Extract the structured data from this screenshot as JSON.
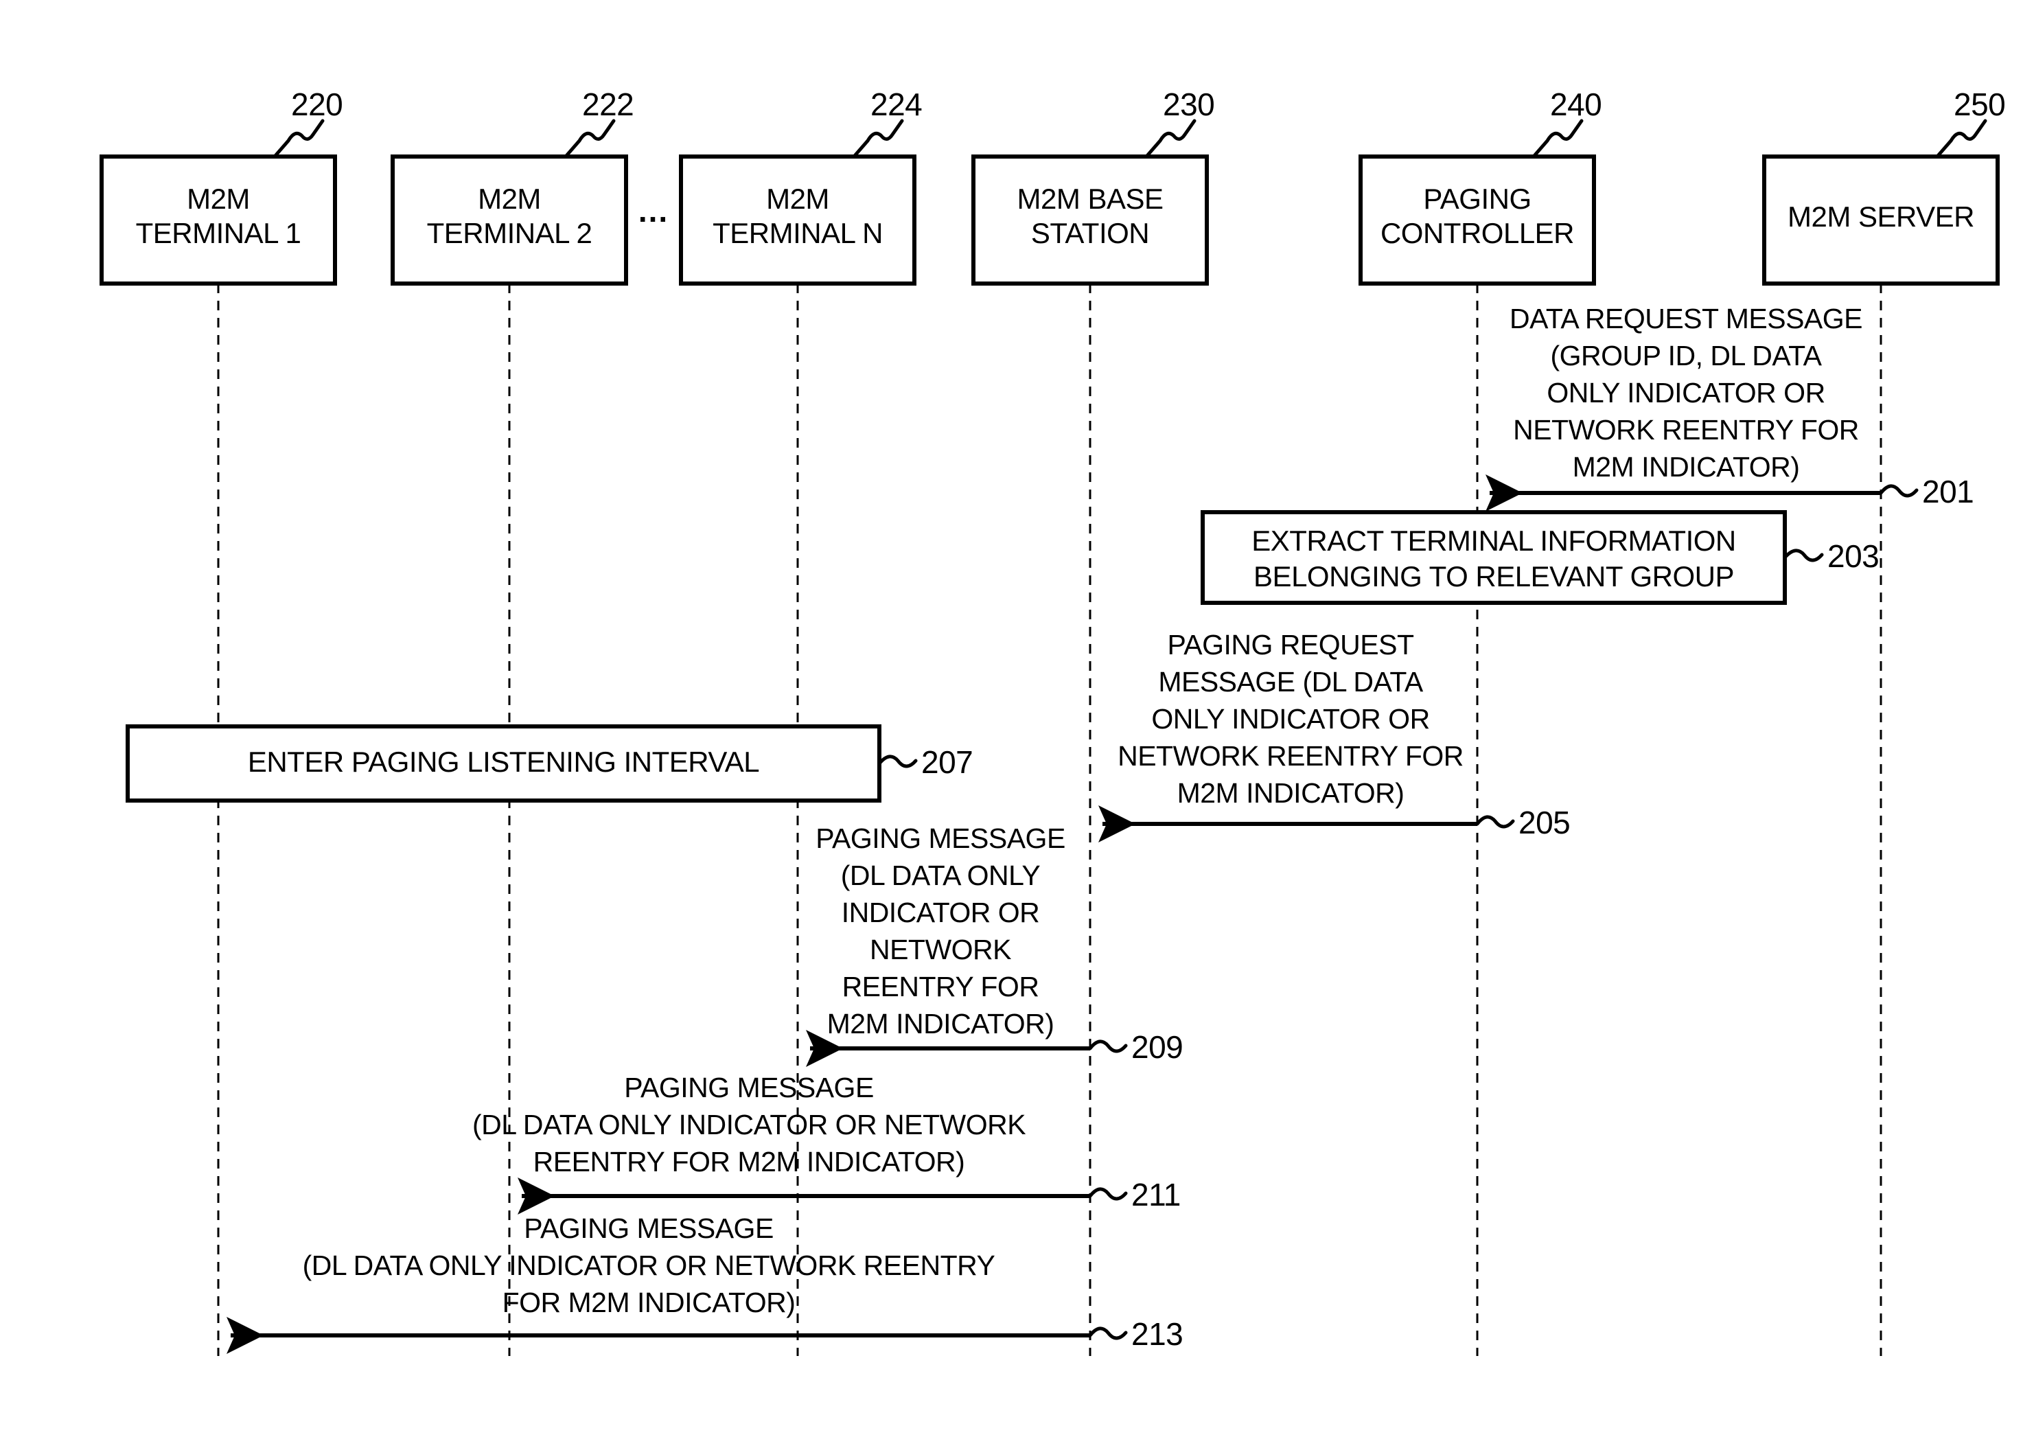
{
  "figure": {
    "type": "patent-sequence-diagram",
    "title": "M2M paging procedure sequence diagram"
  },
  "lifelines": [
    {
      "id": "terminal1",
      "label_line1": "M2M",
      "label_line2": "TERMINAL 1",
      "ref": "220"
    },
    {
      "id": "terminal2",
      "label_line1": "M2M",
      "label_line2": "TERMINAL 2",
      "ref": "222"
    },
    {
      "id": "terminalN",
      "label_line1": "M2M",
      "label_line2": "TERMINAL N",
      "ref": "224"
    },
    {
      "id": "base_station",
      "label_line1": "M2M BASE",
      "label_line2": "STATION",
      "ref": "230"
    },
    {
      "id": "paging_controller",
      "label_line1": "PAGING",
      "label_line2": "CONTROLLER",
      "ref": "240"
    },
    {
      "id": "m2m_server",
      "label_line1": "M2M SERVER",
      "label_line2": "",
      "ref": "250"
    }
  ],
  "ellipsis": "...",
  "messages": [
    {
      "ref": "201",
      "from": "m2m_server",
      "to": "paging_controller",
      "lines": [
        "DATA REQUEST MESSAGE",
        "(GROUP ID, DL DATA",
        "ONLY INDICATOR OR",
        "NETWORK REENTRY FOR",
        "M2M INDICATOR)"
      ]
    },
    {
      "ref": "205",
      "from": "paging_controller",
      "to": "base_station",
      "lines": [
        "PAGING REQUEST",
        "MESSAGE (DL DATA",
        "ONLY INDICATOR OR",
        "NETWORK REENTRY FOR",
        "M2M INDICATOR)"
      ]
    },
    {
      "ref": "209",
      "from": "base_station",
      "to": "terminalN",
      "lines": [
        "PAGING MESSAGE",
        "(DL DATA ONLY",
        "INDICATOR OR",
        "NETWORK",
        "REENTRY FOR",
        "M2M INDICATOR)"
      ]
    },
    {
      "ref": "211",
      "from": "base_station",
      "to": "terminal2",
      "lines": [
        "PAGING MESSAGE",
        "(DL DATA ONLY INDICATOR OR NETWORK",
        "REENTRY FOR M2M INDICATOR)"
      ]
    },
    {
      "ref": "213",
      "from": "base_station",
      "to": "terminal1",
      "lines": [
        "PAGING MESSAGE",
        "(DL DATA ONLY INDICATOR OR NETWORK REENTRY",
        "FOR M2M INDICATOR)"
      ]
    }
  ],
  "process_boxes": [
    {
      "ref": "203",
      "lines": [
        "EXTRACT TERMINAL INFORMATION",
        "BELONGING TO RELEVANT GROUP"
      ]
    },
    {
      "ref": "207",
      "lines": [
        "ENTER PAGING LISTENING INTERVAL"
      ]
    }
  ],
  "colors": {
    "line": "#000000",
    "background": "#ffffff",
    "text": "#000000"
  }
}
